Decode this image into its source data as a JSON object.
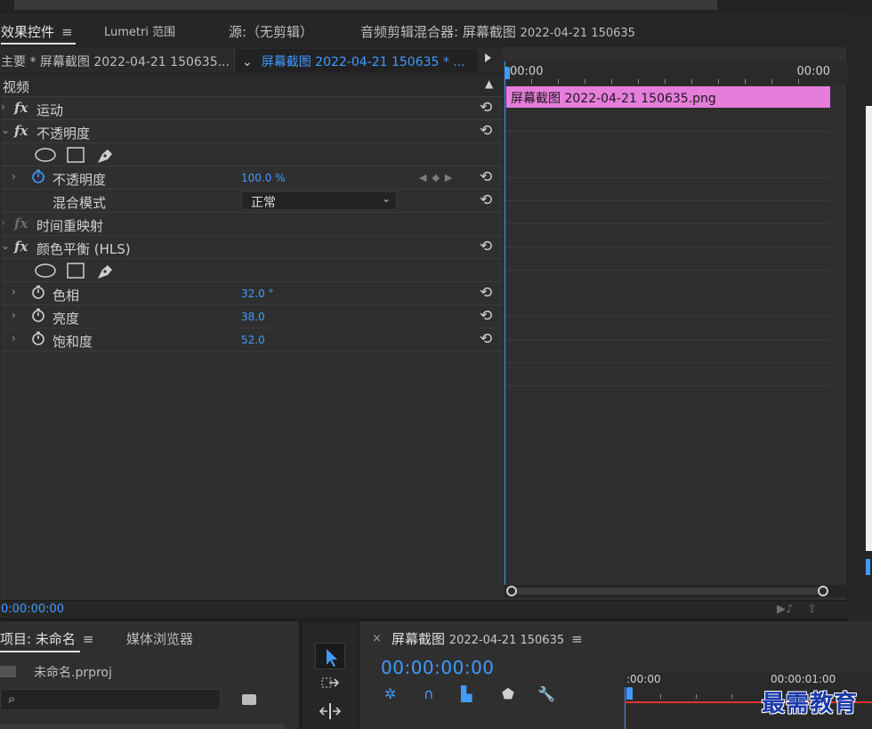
{
  "tabs": {
    "effect_controls": "效果控件",
    "lumetri": "Lumetri 范围",
    "source": "源:（无剪辑）",
    "audio_mixer": "音频剪辑混合器: 屏幕截图",
    "audio_mixer_suffix": "2022-04-21 150635"
  },
  "effect_controls": {
    "master_label": "主要 * 屏幕截图 2022-04-21 150635...",
    "clip_label": "屏幕截图 2022-04-21 150635 * ...",
    "section_video": "视频",
    "motion": "运动",
    "opacity_group": "不透明度",
    "opacity_param": "不透明度",
    "opacity_value": "100.0 %",
    "blend_mode_label": "混合模式",
    "blend_mode_value": "正常",
    "time_remap": "时间重映射",
    "color_balance": "颜色平衡 (HLS)",
    "hue_label": "色相",
    "hue_value": "32.0 °",
    "lightness_label": "亮度",
    "lightness_value": "38.0",
    "saturation_label": "饱和度",
    "saturation_value": "52.0",
    "footer_timecode": "0:00:00:00"
  },
  "timeline_mini": {
    "start_time": "00:00",
    "end_time": "00:00",
    "clip_name": "屏幕截图 2022-04-21  150635.png",
    "clip_color": "#e57ddb"
  },
  "project": {
    "title": "项目: 未命名",
    "media_browser": "媒体浏览器",
    "file": "未命名.prproj"
  },
  "sequence": {
    "title": "屏幕截图",
    "title_suffix": "2022-04-21 150635",
    "timecode": "00:00:00:00",
    "ruler_start": ":00:00",
    "ruler_next": "00:00:01:00"
  },
  "watermark": "最需教育",
  "colors": {
    "accent": "#3f9bff",
    "panel": "#2f2f2f",
    "playhead_range": "#e0342b"
  }
}
